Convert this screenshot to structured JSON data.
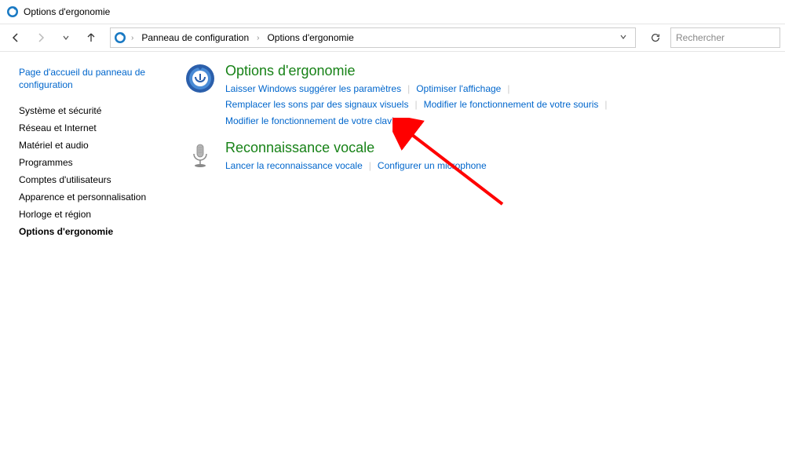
{
  "window": {
    "title": "Options d'ergonomie"
  },
  "breadcrumb": {
    "root": "Panneau de configuration",
    "current": "Options d'ergonomie"
  },
  "search": {
    "placeholder": "Rechercher"
  },
  "sidebar": {
    "home": "Page d'accueil du panneau de configuration",
    "items": [
      {
        "label": "Système et sécurité"
      },
      {
        "label": "Réseau et Internet"
      },
      {
        "label": "Matériel et audio"
      },
      {
        "label": "Programmes"
      },
      {
        "label": "Comptes d'utilisateurs"
      },
      {
        "label": "Apparence et personnalisation"
      },
      {
        "label": "Horloge et région"
      },
      {
        "label": "Options d'ergonomie"
      }
    ]
  },
  "categories": [
    {
      "title": "Options d'ergonomie",
      "icon": "ease-of-access",
      "links": [
        "Laisser Windows suggérer les paramètres",
        "Optimiser l'affichage",
        "Remplacer les sons par des signaux visuels",
        "Modifier le fonctionnement de votre souris",
        "Modifier le fonctionnement de votre clavier"
      ]
    },
    {
      "title": "Reconnaissance vocale",
      "icon": "microphone",
      "links": [
        "Lancer la reconnaissance vocale",
        "Configurer un microphone"
      ]
    }
  ]
}
